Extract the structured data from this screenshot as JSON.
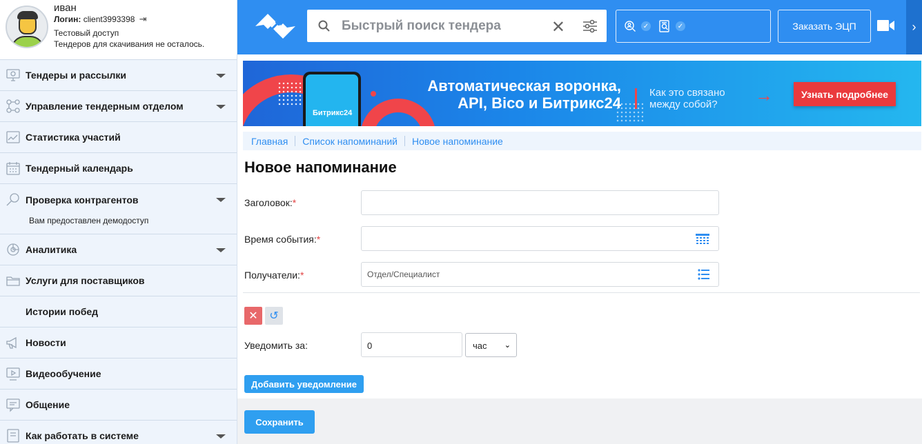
{
  "profile": {
    "name": "иван",
    "login_label": "Логин:",
    "login_value": "client3993398",
    "access": "Тестовый доступ",
    "downloads": "Тендеров для скачивания не осталось."
  },
  "sidebar": {
    "items": [
      {
        "label": "Тендеры и рассылки",
        "icon": "monitor-icon",
        "chevron": true
      },
      {
        "label": "Управление тендерным отделом",
        "icon": "org-chart-icon",
        "chevron": true
      },
      {
        "label": "Статистика участий",
        "icon": "stats-chart-icon",
        "chevron": false
      },
      {
        "label": "Тендерный календарь",
        "icon": "calendar-icon",
        "chevron": false
      },
      {
        "label": "Проверка контрагентов",
        "icon": "magnifier-icon",
        "chevron": true,
        "sub": "Вам предоставлен демодоступ"
      },
      {
        "label": "Аналитика",
        "icon": "pie-chart-icon",
        "chevron": true
      },
      {
        "label": "Услуги для поставщиков",
        "icon": "folder-icon",
        "chevron": false
      },
      {
        "label": "Истории побед",
        "icon": "",
        "chevron": false
      },
      {
        "label": "Новости",
        "icon": "megaphone-icon",
        "chevron": false
      },
      {
        "label": "Видеообучение",
        "icon": "video-lesson-icon",
        "chevron": false
      },
      {
        "label": "Общение",
        "icon": "chat-icon",
        "chevron": false
      },
      {
        "label": "Как работать в системе",
        "icon": "help-book-icon",
        "chevron": true
      }
    ]
  },
  "topbar": {
    "search_placeholder": "Быстрый поиск тендера",
    "ecp_label": "Заказать ЭЦП",
    "check1": "✓",
    "check2": "✓"
  },
  "banner": {
    "title_line1": "Автоматическая воронка,",
    "title_line2": "API, Bico и Битрикс24",
    "question_line1": "Как это связано",
    "question_line2": "между собой?",
    "phone_brand": "Битрикс24",
    "button": "Узнать подробнее"
  },
  "breadcrumbs": [
    "Главная",
    "Список напоминаний",
    "Новое напоминание"
  ],
  "form": {
    "title": "Новое напоминание",
    "title_label": "Заголовок:",
    "time_label": "Время события:",
    "recipients_label": "Получатели:",
    "recipients_placeholder": "Отдел/Специалист",
    "required_mark": "*",
    "notify_label": "Уведомить за:",
    "notify_value": "0",
    "notify_unit": "час",
    "add_notification": "Добавить уведомление",
    "save": "Сохранить"
  },
  "colors": {
    "accent": "#2f8ef1",
    "banner_red": "#ea3a3d",
    "sidebar_bg": "#eef4fc"
  }
}
